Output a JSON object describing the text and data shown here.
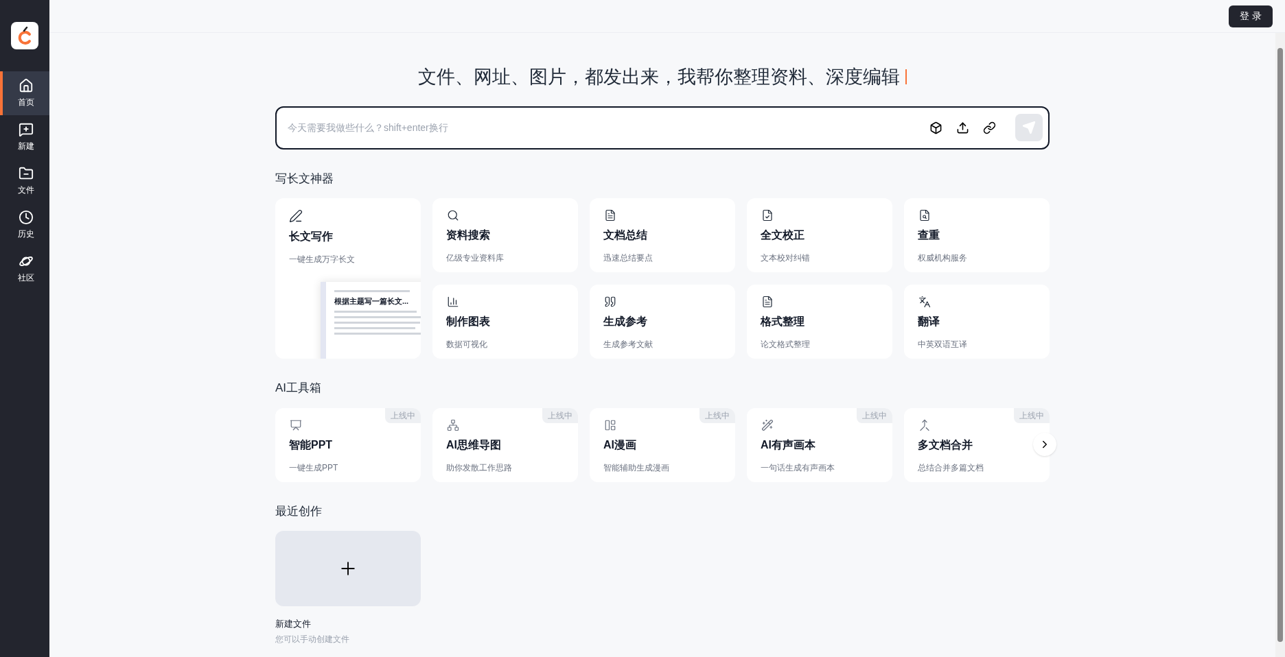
{
  "sidebar": {
    "items": [
      {
        "kind": "home",
        "label": "首页",
        "selected": true
      },
      {
        "kind": "new",
        "label": "新建",
        "selected": false
      },
      {
        "kind": "files",
        "label": "文件",
        "selected": false
      },
      {
        "kind": "history",
        "label": "历史",
        "selected": false
      },
      {
        "kind": "community",
        "label": "社区",
        "selected": false
      }
    ]
  },
  "header": {
    "login_button": "登 录"
  },
  "hero": {
    "title": "文件、网址、图片，都发出来，我帮你整理资料、深度编辑"
  },
  "prompt": {
    "placeholder": "今天需要我做些什么？shift+enter换行"
  },
  "writing_tools": {
    "title": "写长文神器",
    "featured": {
      "kind": "pen",
      "title": "长文写作",
      "subtitle": "一键生成万字长文",
      "preview_title": "根据主题写一篇长文..."
    },
    "cards": [
      {
        "kind": "search",
        "title": "资料搜索",
        "subtitle": "亿级专业资料库"
      },
      {
        "kind": "summary",
        "title": "文档总结",
        "subtitle": "迅速总结要点"
      },
      {
        "kind": "proofread",
        "title": "全文校正",
        "subtitle": "文本校对纠错"
      },
      {
        "kind": "duplicate",
        "title": "查重",
        "subtitle": "权威机构服务"
      },
      {
        "kind": "chart",
        "title": "制作图表",
        "subtitle": "数据可视化"
      },
      {
        "kind": "reference",
        "title": "生成参考",
        "subtitle": "生成参考文献"
      },
      {
        "kind": "format",
        "title": "格式整理",
        "subtitle": "论文格式整理"
      },
      {
        "kind": "translate",
        "title": "翻译",
        "subtitle": "中英双语互译"
      }
    ]
  },
  "ai_toolbox": {
    "title": "AI工具箱",
    "cards": [
      {
        "kind": "ppt",
        "title": "智能PPT",
        "subtitle": "一键生成PPT",
        "badge": "上线中"
      },
      {
        "kind": "mindmap",
        "title": "AI思维导图",
        "subtitle": "助你发散工作思路",
        "badge": "上线中"
      },
      {
        "kind": "comic",
        "title": "AI漫画",
        "subtitle": "智能辅助生成漫画",
        "badge": "上线中"
      },
      {
        "kind": "audiobook",
        "title": "AI有声画本",
        "subtitle": "一句话生成有声画本",
        "badge": "上线中"
      },
      {
        "kind": "merge",
        "title": "多文档合并",
        "subtitle": "总结合并多篇文档",
        "badge": "上线中"
      }
    ]
  },
  "recent": {
    "title": "最近创作",
    "new_file": {
      "title": "新建文件",
      "subtitle": "您可以手动创建文件"
    }
  }
}
